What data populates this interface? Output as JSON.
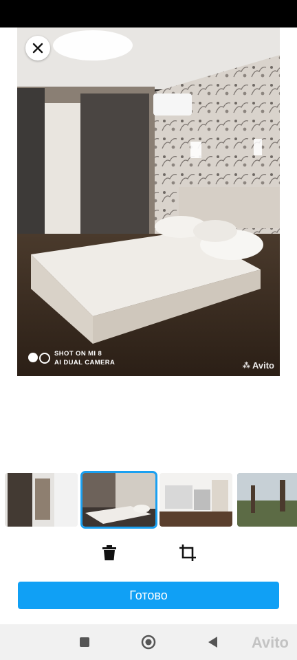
{
  "photo": {
    "camera_line1": "SHOT ON MI 8",
    "camera_line2": "AI DUAL CAMERA",
    "watermark": "Avito"
  },
  "icons": {
    "close": "close-icon",
    "delete": "trash-icon",
    "crop": "crop-icon",
    "nav_recents": "square-icon",
    "nav_home": "circle-icon",
    "nav_back": "triangle-icon"
  },
  "thumbnails": [
    {
      "label": "hallway"
    },
    {
      "label": "bedroom",
      "selected": true
    },
    {
      "label": "kitchen"
    },
    {
      "label": "yard"
    }
  ],
  "done_button": "Готово",
  "nav_watermark": "Avito",
  "colors": {
    "accent": "#10a0f5",
    "selection": "#1aa0f1"
  }
}
